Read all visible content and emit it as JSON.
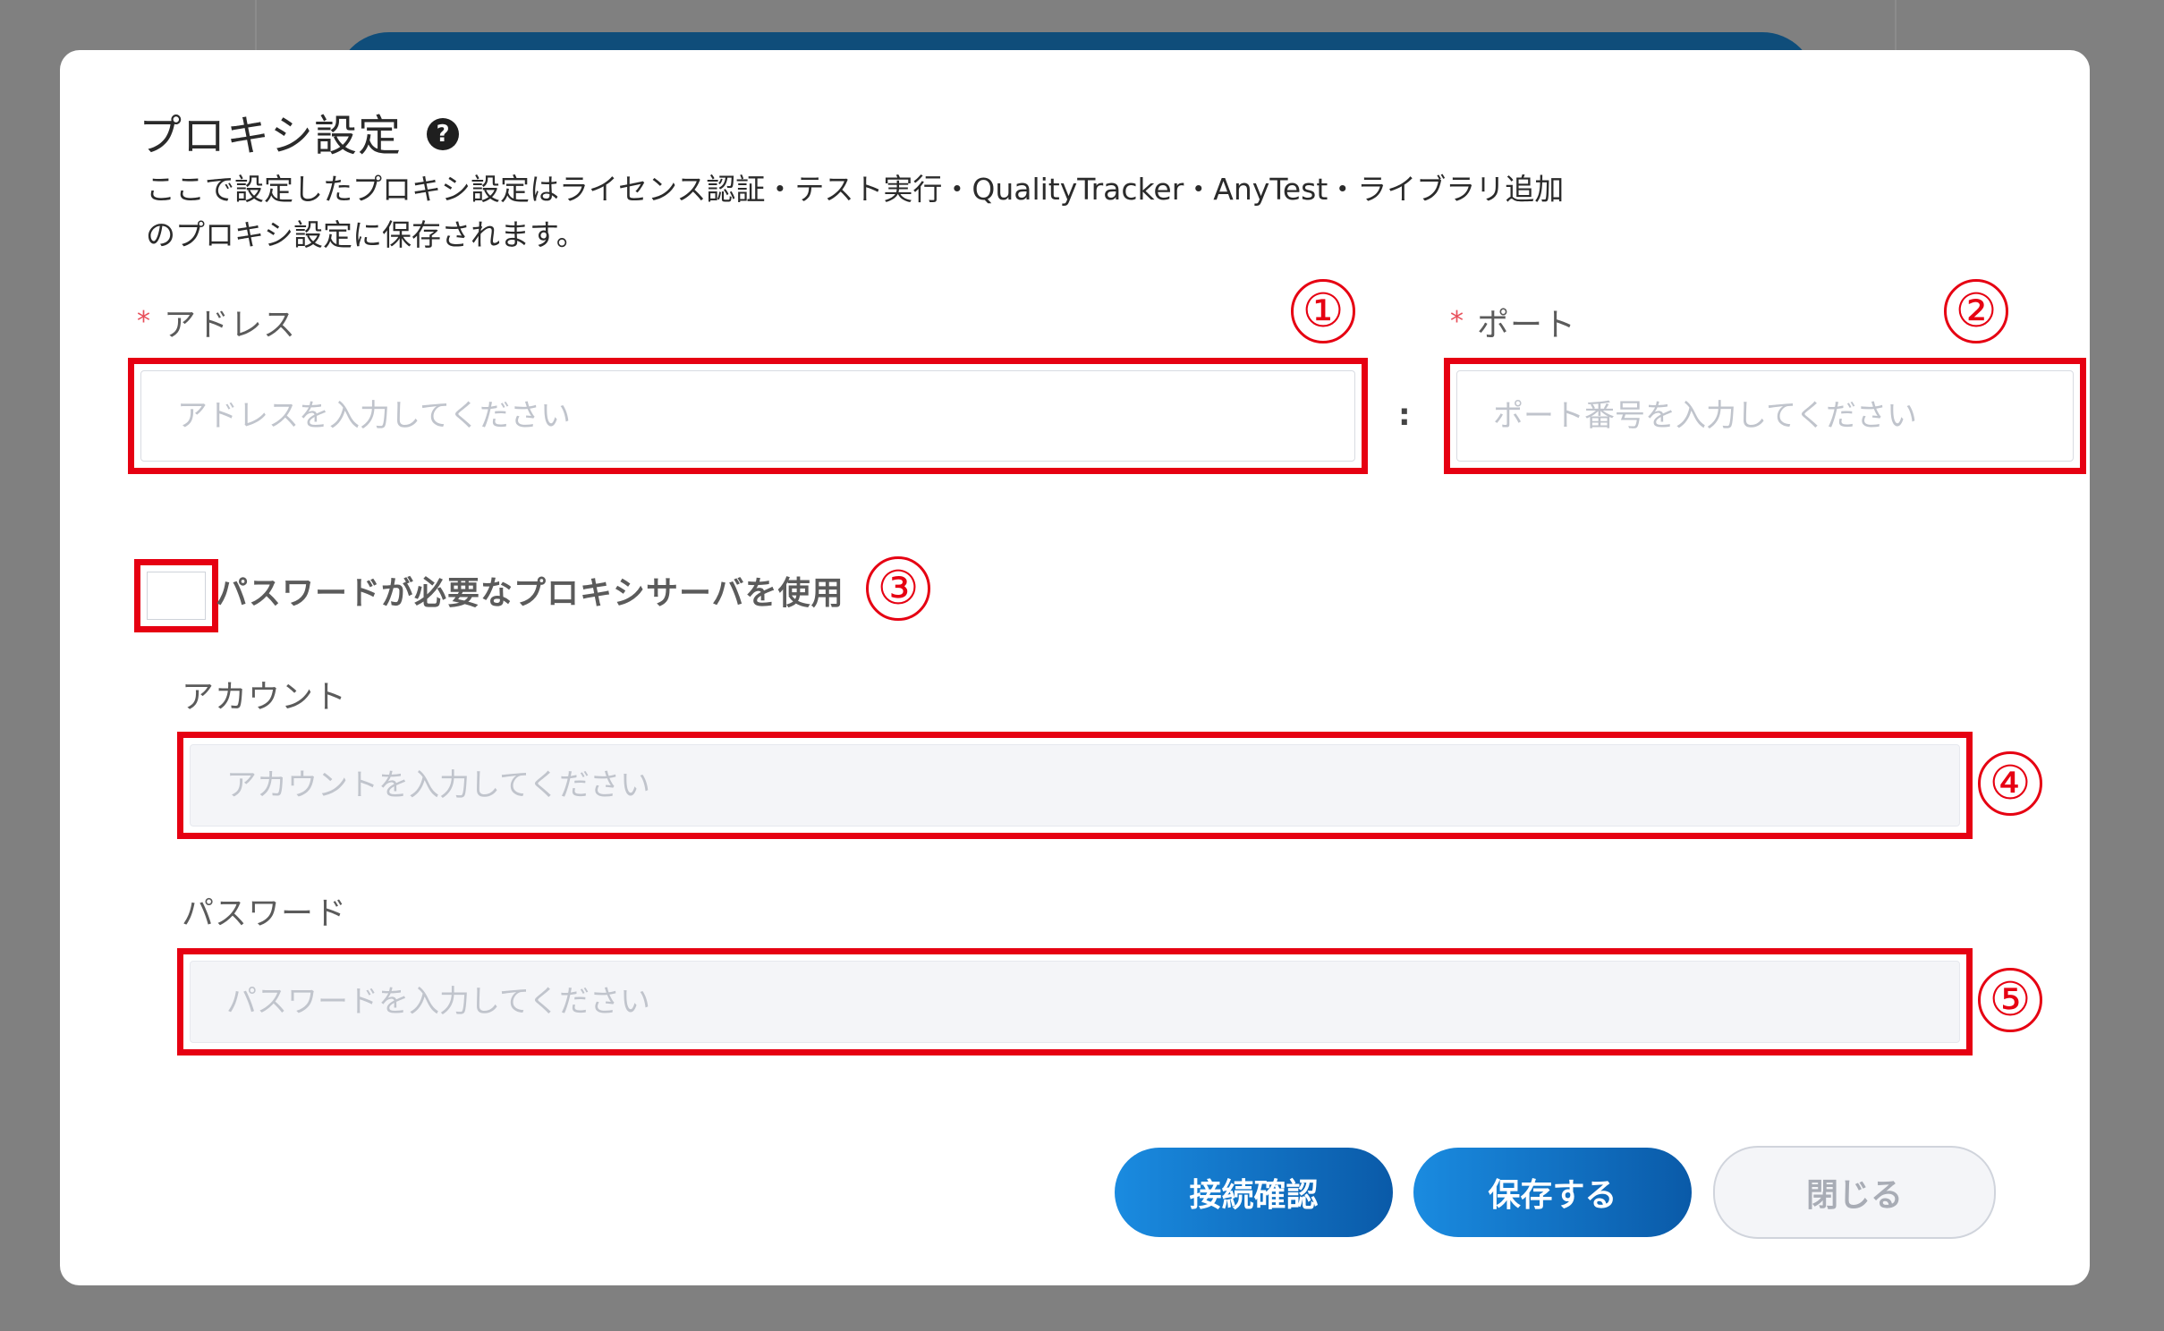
{
  "dialog": {
    "title": "プロキシ設定",
    "help_icon": "question-circle-icon",
    "description_line1": "ここで設定したプロキシ設定はライセンス認証・テスト実行・QualityTracker・AnyTest・ライブラリ追加",
    "description_line2": "のプロキシ設定に保存されます。"
  },
  "address": {
    "required_mark": "*",
    "label": "アドレス",
    "placeholder": "アドレスを入力してください",
    "value": ""
  },
  "separator": ":",
  "port": {
    "required_mark": "*",
    "label": "ポート",
    "placeholder": "ポート番号を入力してください",
    "value": ""
  },
  "auth_checkbox": {
    "label": "パスワードが必要なプロキシサーバを使用",
    "checked": false
  },
  "account": {
    "label": "アカウント",
    "placeholder": "アカウントを入力してください",
    "value": ""
  },
  "password": {
    "label": "パスワード",
    "placeholder": "パスワードを入力してください",
    "value": ""
  },
  "buttons": {
    "test_connection": "接続確認",
    "save": "保存する",
    "close": "閉じる"
  },
  "annotations": [
    "①",
    "②",
    "③",
    "④",
    "⑤"
  ],
  "colors": {
    "highlight": "#e60012",
    "primary_button": "#1a8be0",
    "required": "#e8505b"
  }
}
